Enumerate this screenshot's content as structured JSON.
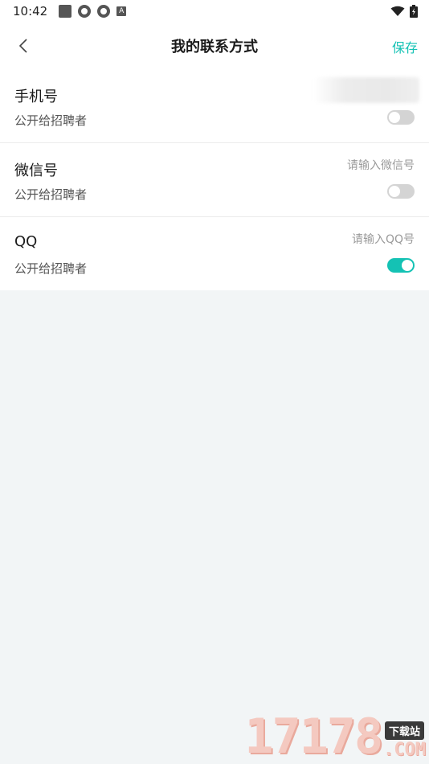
{
  "status_bar": {
    "time": "10:42",
    "icons": [
      "square-icon",
      "aperture-icon",
      "aperture-icon",
      "a-badge-icon"
    ],
    "right_icons": [
      "wifi-icon",
      "battery-icon"
    ]
  },
  "nav": {
    "title": "我的联系方式",
    "save_label": "保存",
    "accent_color": "#14c2b4"
  },
  "rows": [
    {
      "label": "手机号",
      "sub_label": "公开给招聘者",
      "value": "",
      "placeholder": "",
      "toggle_on": false
    },
    {
      "label": "微信号",
      "sub_label": "公开给招聘者",
      "value": "",
      "placeholder": "请输入微信号",
      "toggle_on": false
    },
    {
      "label": "QQ",
      "sub_label": "公开给招聘者",
      "value": "",
      "placeholder": "请输入QQ号",
      "toggle_on": true
    }
  ],
  "watermark": {
    "number": "17178",
    "tag": "下载站",
    "suffix": ".COM"
  }
}
